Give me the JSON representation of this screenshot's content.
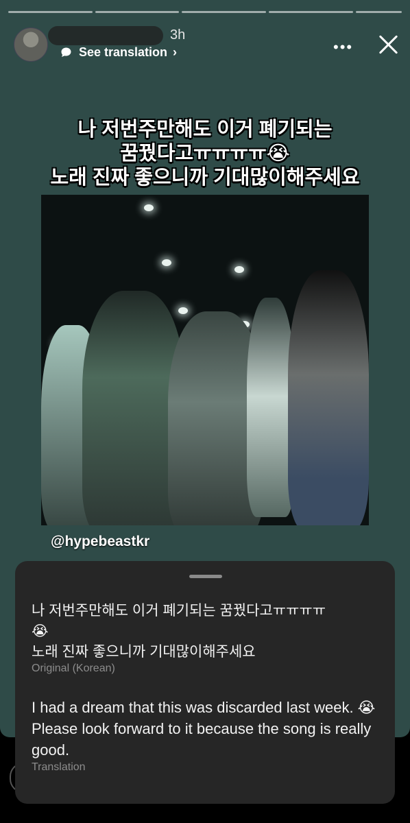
{
  "story": {
    "time_ago": "3h",
    "see_translation": "See translation",
    "more_label": "•••",
    "close_icon": "close-icon",
    "chevron": "›",
    "progress_segments": 5
  },
  "caption": {
    "line1": "나 저번주만해도 이거 폐기되는",
    "line2": "꿈꿨다고ㅠㅠㅠㅠ😭",
    "line3": "노래 진짜 좋으니까 기대많이해주세요"
  },
  "photo": {
    "credit": "@hypebeastkr"
  },
  "translation_sheet": {
    "original_text_line1": "나 저번주만해도 이거 폐기되는 꿈꿨다고ㅠㅠㅠㅠ",
    "original_text_line2": "😭",
    "original_text_line3": "노래 진짜 좋으니까 기대많이해주세요",
    "original_label": "Original (Korean)",
    "translated_text": "I had a dream that this was discarded last week. 😭 Please look forward to it because the song is really good.",
    "translation_label": "Translation"
  },
  "colors": {
    "story_background": "#2f4b48",
    "sheet_background": "#262626",
    "label_gray": "#8c8c8c"
  }
}
